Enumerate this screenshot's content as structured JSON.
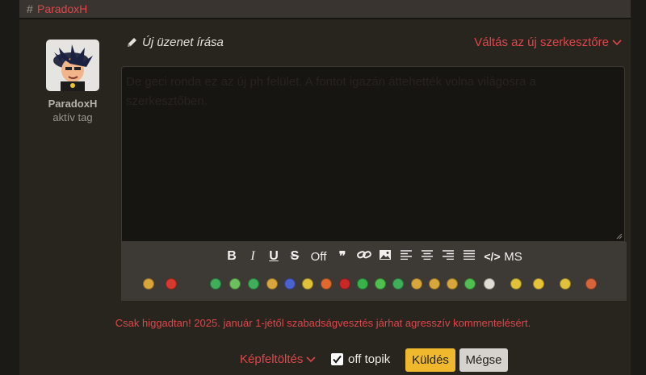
{
  "header": {
    "hash": "#",
    "username": "ParadoxH"
  },
  "user": {
    "name": "ParadoxH",
    "role": "aktív tag"
  },
  "compose": {
    "title": "Új üzenet írása",
    "switch_editor": "Váltás az új szerkesztőre",
    "body": "De geci ronda ez az új ph felület. A fontot igazán áttehették volna világosra a szerkesztőben."
  },
  "toolbar": {
    "bold": "B",
    "italic": "I",
    "underline": "U",
    "strike": "S",
    "off": "Off",
    "quote": "❞",
    "link": "🔗",
    "image": "▣",
    "align_left": "≡",
    "align_center": "≡",
    "align_right": "≡",
    "justify": "≡",
    "code": "</>",
    "ms": "MS"
  },
  "smileys": [
    {
      "icon": "smile-icon",
      "color": "#d8a63a"
    },
    {
      "icon": "angry-icon",
      "color": "#d63a2e"
    },
    {
      "icon": "teeth-icon",
      "color": "#3fae5a"
    },
    {
      "icon": "grin-icon",
      "color": "#6fbf5f"
    },
    {
      "icon": "laugh-icon",
      "color": "#3fae5a"
    },
    {
      "icon": "surprised-icon",
      "color": "#d8a63a"
    },
    {
      "icon": "sad-blue-icon",
      "color": "#4a62d0"
    },
    {
      "icon": "confused-icon",
      "color": "#e0c23a"
    },
    {
      "icon": "mad-icon",
      "color": "#e06a2e"
    },
    {
      "icon": "red-icon",
      "color": "#c8282a"
    },
    {
      "icon": "sick-icon",
      "color": "#37b24a"
    },
    {
      "icon": "green-grin-icon",
      "color": "#4fbf4f"
    },
    {
      "icon": "green-smile-icon",
      "color": "#3fae5a"
    },
    {
      "icon": "wink-icon",
      "color": "#d8a63a"
    },
    {
      "icon": "tongue-icon",
      "color": "#d8a63a"
    },
    {
      "icon": "smirk-icon",
      "color": "#d8a63a"
    },
    {
      "icon": "nauseous-icon",
      "color": "#4fbf4f"
    },
    {
      "icon": "clap-icon",
      "color": "#e0ddd5"
    },
    {
      "icon": "hmm-icon",
      "color": "#e0c23a"
    },
    {
      "icon": "scream-icon",
      "color": "#e6c23a"
    },
    {
      "icon": "shrug-icon",
      "color": "#e0c23a"
    },
    {
      "icon": "love-icon",
      "color": "#d8653a"
    }
  ],
  "notice": "Csak higgadtan! 2025. január 1-jétől szabadságvesztés járhat agresszív kommentelésért.",
  "actions": {
    "upload": "Képfeltöltés",
    "off_topic": "off topik",
    "send": "Küldés",
    "cancel": "Mégse"
  },
  "colors": {
    "accent": "#e0454a",
    "send_bg": "#f0b92d",
    "panel_bg": "#28251f"
  }
}
